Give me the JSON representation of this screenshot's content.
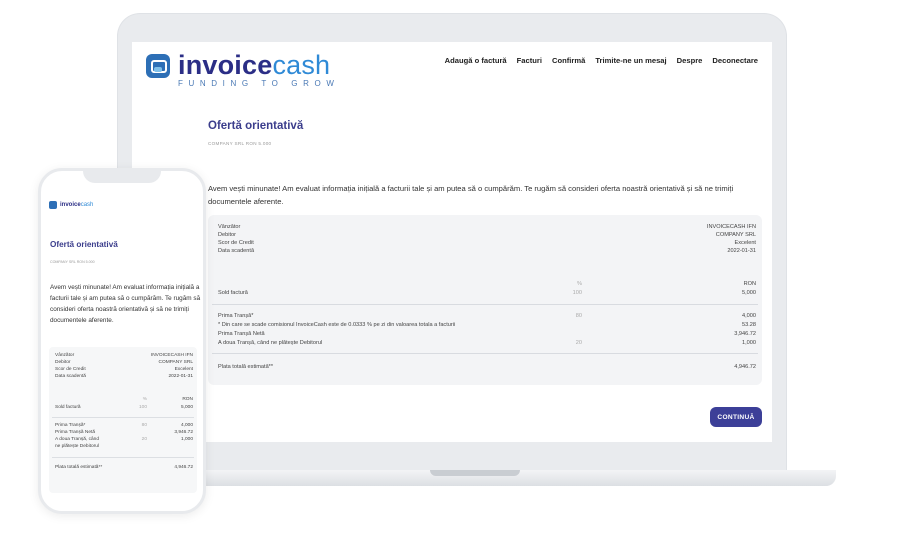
{
  "brand": {
    "name_bold": "invoice",
    "name_light": "cash",
    "tagline": "FUNDING TO GROW"
  },
  "nav": {
    "add_invoice": "Adaugă o factură",
    "invoices": "Facturi",
    "confirm": "Confirmă",
    "message": "Trimite-ne un mesaj",
    "about": "Despre",
    "logout": "Deconectare"
  },
  "offer": {
    "title": "Ofertă orientativă",
    "subtitle": "COMPANY SRL RON 5.000",
    "lead": "Avem vești minunate! Am evaluat informația inițială a facturii tale și am putea să o cumpărăm. Te rugăm să consideri oferta noastră orientativă și să ne trimiți documentele aferente."
  },
  "details": {
    "seller_label": "Vânzător",
    "seller_value": "INVOICECASH IFN",
    "debtor_label": "Debitor",
    "debtor_value": "COMPANY SRL",
    "score_label": "Scor de Credit",
    "score_value": "Excelent",
    "due_label": "Data scadentă",
    "due_value": "2022-01-31",
    "pct_header": "%",
    "ron_header": "RON",
    "balance_label": "Sold factură",
    "balance_pct": "100",
    "balance_value": "5,000",
    "first_label": "Prima Tranșă*",
    "first_pct": "80",
    "first_value": "4,000",
    "commission_note": "* Din care se scade comisionul InvoiceCash este de 0.0333 % pe zi din valoarea totala a facturii",
    "commission_value": "53.28",
    "net_label": "Prima Tranșă Netă",
    "net_value": "3,946.72",
    "second_label": "A doua Tranșă, când ne plătește Debitorul",
    "second_pct": "20",
    "second_value": "1,000",
    "total_label": "Plata totală estimată**",
    "total_value": "4,946.72"
  },
  "phone": {
    "brand": "invoicecash",
    "second_label_line1": "A doua Tranșă, când",
    "second_label_line2": "ne plătește Debitorul"
  },
  "actions": {
    "continue": "CONTINUĂ"
  }
}
